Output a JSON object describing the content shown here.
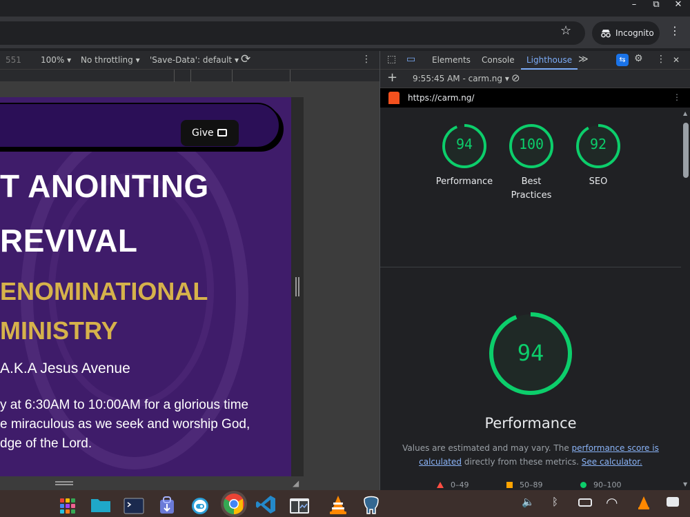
{
  "window": {
    "minimize_glyph": "–",
    "maximize_glyph": "⧉",
    "close_glyph": "✕"
  },
  "browser": {
    "star_glyph": "☆",
    "incognito_label": "Incognito",
    "incognito_icon": "incognito-icon",
    "menu_glyph": "⋮"
  },
  "device_toolbar": {
    "width_value": "551",
    "zoom": "100%",
    "zoom_caret": "▾",
    "throttling": "No throttling",
    "throttling_caret": "▾",
    "save_data": "'Save-Data': default",
    "save_data_caret": "▾",
    "rotate_glyph": "⟳",
    "menu_glyph": "⋮"
  },
  "site": {
    "give_label": "Give",
    "heading_line1": "T ANOINTING",
    "heading_line2": "REVIVAL",
    "subheading_line1": "ENOMINATIONAL",
    "subheading_line2": "MINISTRY",
    "aka": "A.K.A Jesus Avenue",
    "desc_line1": "y at 6:30AM to 10:00AM for a glorious time",
    "desc_line2": "e miraculous as we seek and worship God,",
    "desc_line3": "dge of the Lord."
  },
  "devtools": {
    "inspect_glyph": "⬚",
    "device_glyph": "▭",
    "tabs": [
      "Elements",
      "Console",
      "Lighthouse"
    ],
    "more_tabs_glyph": "≫",
    "badge_glyph": "⇆",
    "settings_glyph": "⚙",
    "menu_glyph": "⋮",
    "close_glyph": "✕",
    "new_report_glyph": "+",
    "report_select": "9:55:45 AM - carm.ng",
    "report_caret": "▾",
    "clear_glyph": "⊘",
    "url": "https://carm.ng/",
    "url_menu_glyph": "⋮"
  },
  "lighthouse": {
    "scores": [
      {
        "value": "94",
        "label": "Performance"
      },
      {
        "value": "100",
        "label": "Best Practices",
        "label_lines": [
          "Best",
          "Practices"
        ]
      },
      {
        "value": "92",
        "label": "SEO"
      }
    ],
    "main_score": "94",
    "main_label": "Performance",
    "note_text1": "Values are estimated and may vary. The ",
    "note_link1": "performance score is calculated",
    "note_link1_a": "performance score is",
    "note_link1_b": "calculated",
    "note_text2": " directly from these metrics. ",
    "note_link2": "See calculator.",
    "legend": [
      {
        "range": "0–49",
        "color": "#ff4e42",
        "shape": "triangle"
      },
      {
        "range": "50–89",
        "color": "#ffa400",
        "shape": "square"
      },
      {
        "range": "90–100",
        "color": "#0cce6b",
        "shape": "circle"
      }
    ],
    "pass_color": "#0cce6b"
  },
  "shelf": {
    "apps": [
      "launcher-icon",
      "files-icon",
      "terminal-icon",
      "store-icon",
      "android-icon",
      "chrome-icon",
      "vscode-icon",
      "system-monitor-icon",
      "vlc-icon",
      "postgres-icon"
    ],
    "tray": [
      "volume-icon",
      "bluetooth-icon",
      "battery-icon",
      "wifi-icon",
      "vlc-tray-icon",
      "notification-icon"
    ]
  }
}
